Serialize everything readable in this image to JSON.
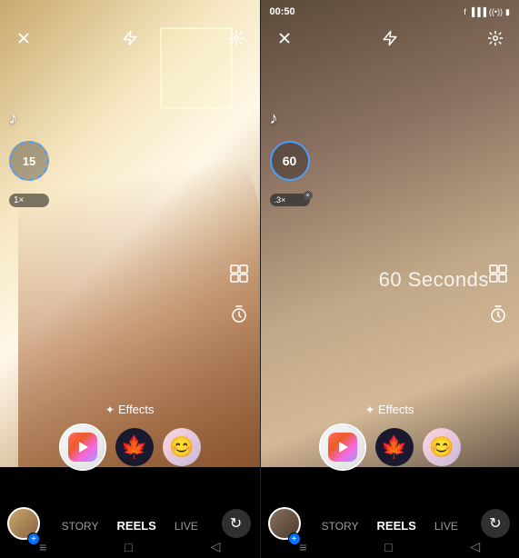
{
  "panels": [
    {
      "id": "left",
      "status_bar": {
        "show": false,
        "time": "",
        "icons": ""
      },
      "top_controls": {
        "close_label": "✕",
        "flash_label": "✈",
        "settings_label": "⚙"
      },
      "timer": {
        "value": "15",
        "type": "dashed"
      },
      "speed": {
        "value": "1×"
      },
      "music_note": "♪",
      "effects_label": "Effects",
      "nav_items": [
        "STORY",
        "REELS",
        "LIVE"
      ],
      "active_nav": "REELS",
      "seconds_label": ""
    },
    {
      "id": "right",
      "status_bar": {
        "show": true,
        "time": "00:50",
        "icons": "📶"
      },
      "top_controls": {
        "close_label": "✕",
        "flash_label": "✈",
        "settings_label": "⚙"
      },
      "timer": {
        "value": "60",
        "type": "solid"
      },
      "speed": {
        "value": ".3×"
      },
      "music_note": "♪",
      "effects_label": "Effects",
      "nav_items": [
        "STORY",
        "REELS",
        "LIVE"
      ],
      "active_nav": "REELS",
      "seconds_label": "60 Seconds"
    }
  ],
  "icons": {
    "close": "✕",
    "flash_off": "⚡",
    "settings": "⚙",
    "grid": "⊞",
    "timer": "⏱",
    "effects": "✦",
    "music": "♪",
    "flip": "↻",
    "menu": "≡",
    "home": "□",
    "back": "◁"
  }
}
